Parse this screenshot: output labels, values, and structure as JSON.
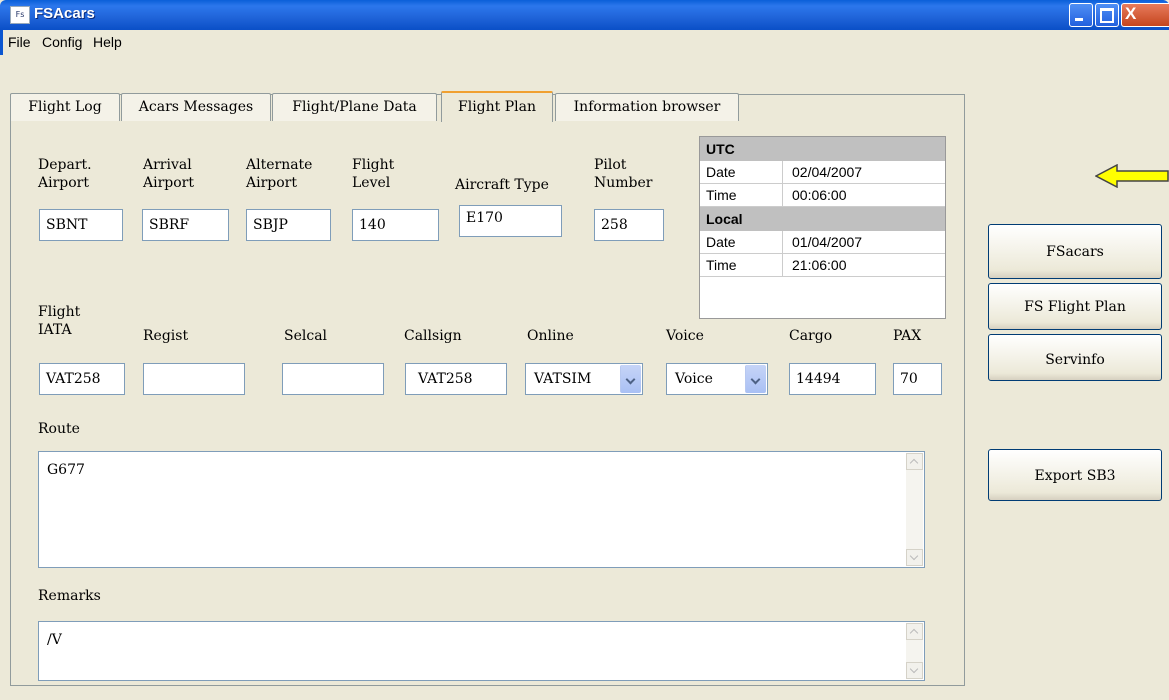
{
  "window": {
    "title": "FSAcars",
    "icon": "fsacars-app-icon"
  },
  "menu": [
    "File",
    "Config",
    "Help"
  ],
  "tabs": [
    {
      "label": "Flight Log",
      "active": false
    },
    {
      "label": "Acars Messages",
      "active": false
    },
    {
      "label": "Flight/Plane Data",
      "active": false
    },
    {
      "label": "Flight Plan",
      "active": true
    },
    {
      "label": "Information browser",
      "active": false
    }
  ],
  "fields": {
    "depart_label": "Depart.\nAirport",
    "depart_value": "SBNT",
    "arrival_label": "Arrival\nAirport",
    "arrival_value": "SBRF",
    "alternate_label": "Alternate\nAirport",
    "alternate_value": "SBJP",
    "level_label": "Flight\nLevel",
    "level_value": "140",
    "aircraft_label": "Aircraft Type",
    "aircraft_value": "E170",
    "pilot_label": "Pilot\nNumber",
    "pilot_value": "258",
    "flight_iata_label": "Flight\nIATA",
    "flight_iata_value": "VAT258",
    "regist_label": "Regist",
    "regist_value": "",
    "selcal_label": "Selcal",
    "selcal_value": "",
    "callsign_label": "Callsign",
    "callsign_value": "VAT258",
    "online_label": "Online",
    "online_value": "VATSIM",
    "voice_label": "Voice",
    "voice_value": "Voice",
    "cargo_label": "Cargo",
    "cargo_value": "14494",
    "pax_label": "PAX",
    "pax_value": "70",
    "route_label": "Route",
    "route_value": "G677",
    "remarks_label": "Remarks",
    "remarks_value": "/V"
  },
  "time_box": {
    "utc_header": "UTC",
    "utc_date_label": "Date",
    "utc_date": "02/04/2007",
    "utc_time_label": "Time",
    "utc_time": "00:06:00",
    "local_header": "Local",
    "local_date_label": "Date",
    "local_date": "01/04/2007",
    "local_time_label": "Time",
    "local_time": "21:06:00"
  },
  "buttons": {
    "fsacars": "FSacars",
    "fs_flight_plan": "FS Flight Plan",
    "servinfo": "Servinfo",
    "export_sb3": "Export SB3"
  },
  "colors": {
    "titlebar": "#0a5fd8",
    "arrow": "#ffff00"
  }
}
